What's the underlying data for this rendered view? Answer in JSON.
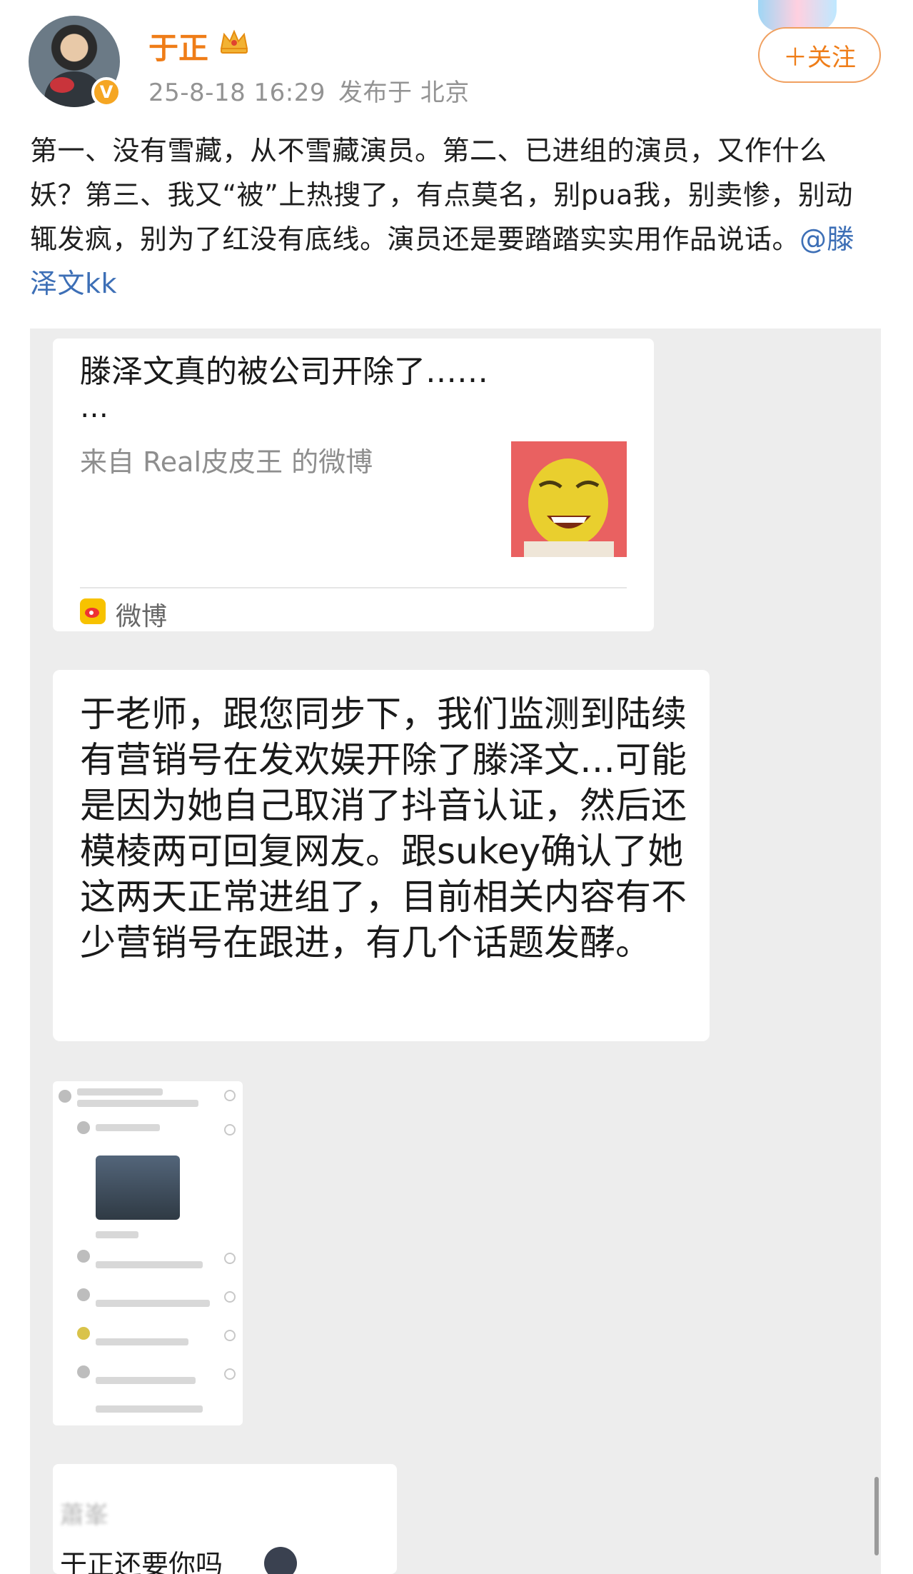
{
  "post": {
    "username": "于正",
    "timestamp": "25-8-18 16:29",
    "location": "发布于 北京",
    "follow_label": "＋关注",
    "text": "第一、没有雪藏，从不雪藏演员。第二、已进组的演员，又作什么妖？第三、我又“被”上热搜了，有点莫名，别pua我，别卖惨，别动辄发疯，别为了红没有底线。演员还是要踏踏实实用作品说话。",
    "mention": "@滕泽文kk",
    "verified_badge": "V"
  },
  "screenshot": {
    "shared_card": {
      "title_line1": "滕泽文真的被公司开除了……",
      "title_line2": "…",
      "source": "来自 Real皮皮王 的微博",
      "platform_label": "微博",
      "thumbnail_icon": "cartoon-face-icon"
    },
    "chat_message": "于老师，跟您同步下，我们监测到陆续有营销号在发欢娱开除了滕泽文…可能是因为她自己取消了抖音认证，然后还模棱两可回复网友。跟sukey确认了她这两天正常进组了，目前相关内容有不少营销号在跟进，有几个话题发酵。",
    "bottom_message": {
      "sender": "蕭峯",
      "text": "于正还要你吗"
    }
  },
  "colors": {
    "username": "#ef7d18",
    "mention": "#3d6fb6",
    "meta": "#939393",
    "chat_bg": "#ededed"
  }
}
